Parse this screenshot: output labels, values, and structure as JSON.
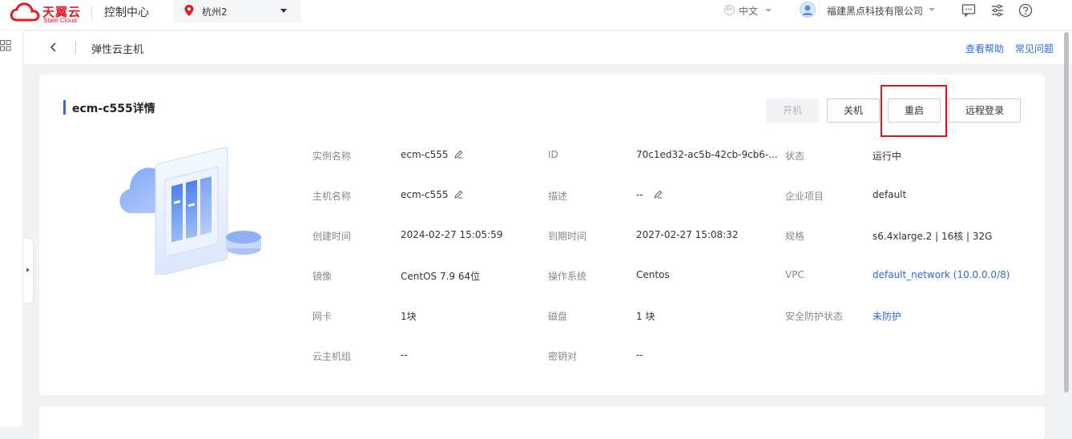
{
  "topbar": {
    "logo_cn": "天翼云",
    "logo_en": "State Cloud",
    "console_title": "控制中心",
    "region": "杭州2",
    "language": "中文",
    "lang_icon_text": "En",
    "company": "福建黑点科技有限公司",
    "icons": [
      "message-icon",
      "settings-icon",
      "help-icon"
    ]
  },
  "subheader": {
    "page_title": "弹性云主机",
    "help_link": "查看帮助",
    "faq_link": "常见问题"
  },
  "card": {
    "title": "ecm-c555详情",
    "buttons": {
      "start": "开机",
      "shutdown": "关机",
      "restart": "重启",
      "remote_login": "远程登录"
    },
    "fields": {
      "instance_name_label": "实例名称",
      "instance_name": "ecm-c555",
      "id_label": "ID",
      "id": "70c1ed32-ac5b-42cb-9cb6-...",
      "status_label": "状态",
      "status": "运行中",
      "host_name_label": "主机名称",
      "host_name": "ecm-c555",
      "desc_label": "描述",
      "desc": "--",
      "project_label": "企业项目",
      "project": "default",
      "created_label": "创建时间",
      "created": "2024-02-27 15:05:59",
      "expire_label": "到期时间",
      "expire": "2027-02-27 15:08:32",
      "spec_label": "规格",
      "spec": "s6.4xlarge.2 | 16核 | 32G",
      "image_label": "镜像",
      "image": "CentOS 7.9 64位",
      "os_label": "操作系统",
      "os": "Centos",
      "vpc_label": "VPC",
      "vpc": "default_network (10.0.0.0/8)",
      "nic_label": "网卡",
      "nic": "1块",
      "disk_label": "磁盘",
      "disk": "1 块",
      "security_label": "安全防护状态",
      "security": "未防护",
      "group_label": "云主机组",
      "group": "--",
      "keypair_label": "密钥对",
      "keypair": "--"
    }
  },
  "colors": {
    "brand_red": "#e31b23",
    "link_blue": "#2e6bd9",
    "highlight_red": "#e0141e"
  }
}
